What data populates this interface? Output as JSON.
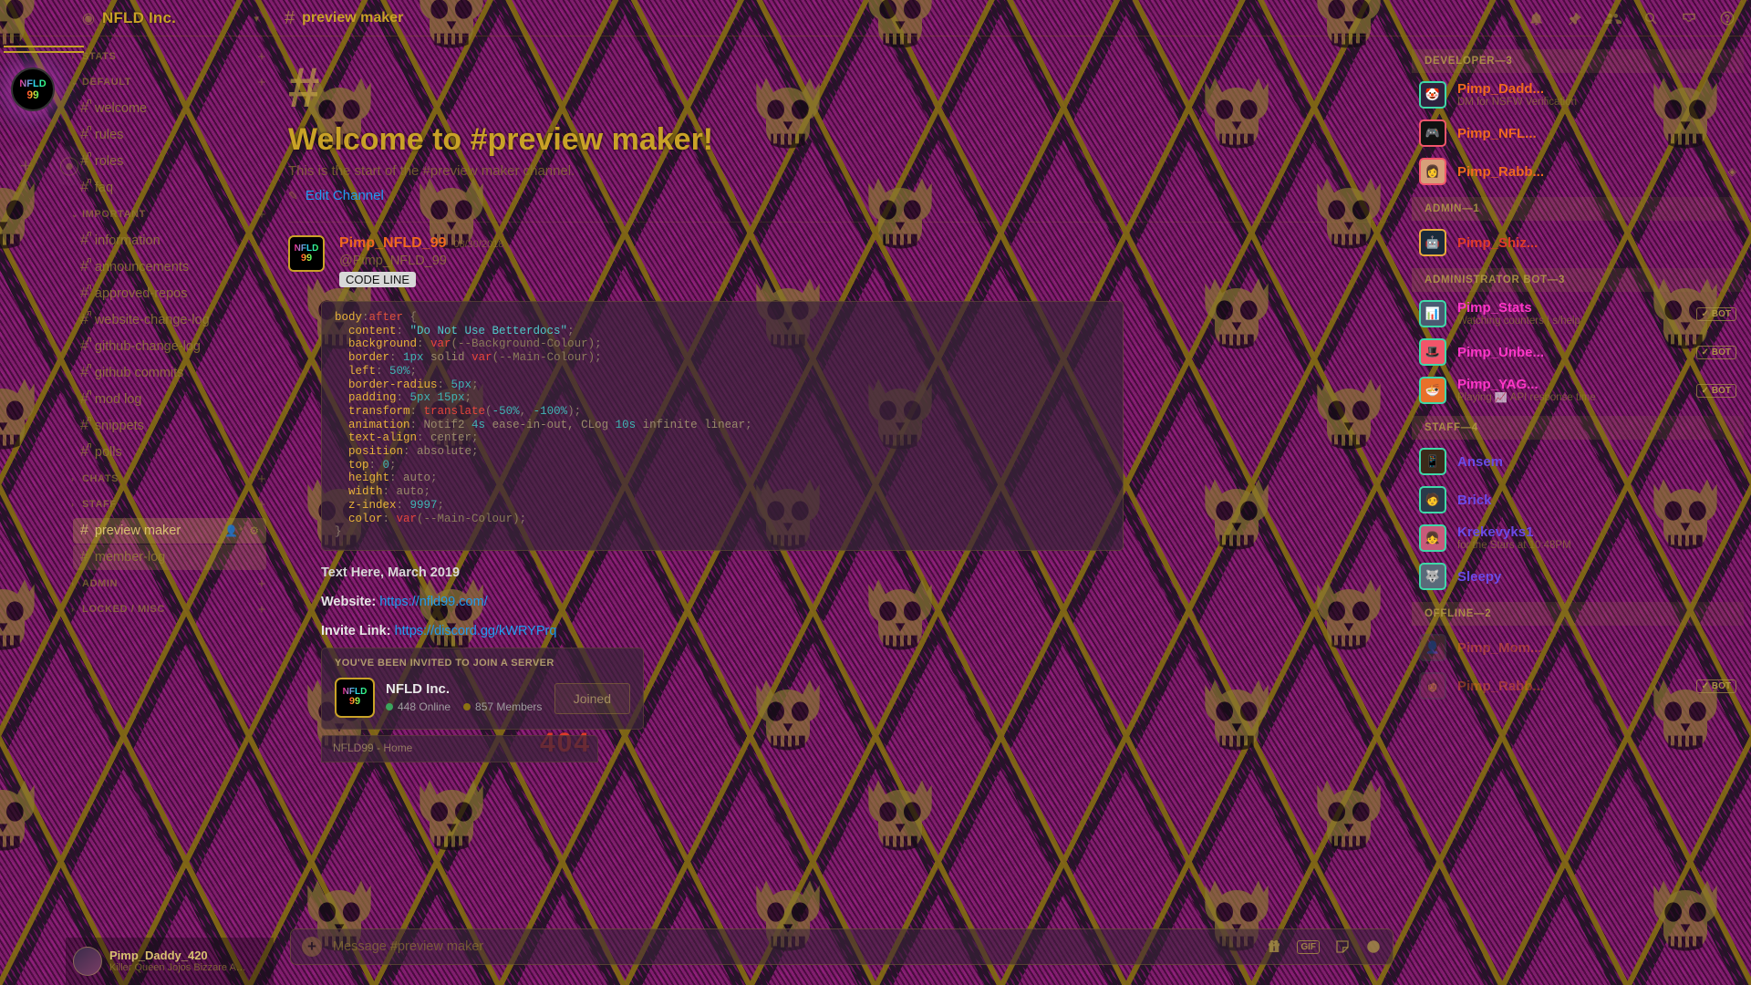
{
  "window": {
    "guild_name": "NFLD Inc.",
    "channel_name": "preview maker",
    "channel_hash": "#"
  },
  "topbar": {
    "icons": [
      {
        "name": "bell-icon",
        "glyph": "🔔"
      },
      {
        "name": "pin-icon",
        "glyph": "📌"
      },
      {
        "name": "members-icon",
        "glyph": "👥"
      },
      {
        "name": "search-icon",
        "glyph": "🔍"
      },
      {
        "name": "inbox-icon",
        "glyph": "📥"
      },
      {
        "name": "help-icon",
        "glyph": "?"
      }
    ]
  },
  "rail": {
    "home_label_line1": "NFLD",
    "home_label_line2": "99",
    "add_server_glyph": "+",
    "explore_glyph": "⦿"
  },
  "sidebar": {
    "categories": [
      {
        "label": "STATS",
        "collapsed": true,
        "arrow": "›",
        "channels": []
      },
      {
        "label": "DEFAULT",
        "collapsed": false,
        "arrow": "⌄",
        "channels": [
          {
            "name": "welcome",
            "locked": true
          },
          {
            "name": "rules",
            "locked": true
          },
          {
            "name": "roles",
            "locked": true
          },
          {
            "name": "faq",
            "locked": true
          }
        ]
      },
      {
        "label": "IMPORTANT",
        "collapsed": false,
        "arrow": "⌄",
        "channels": [
          {
            "name": "information",
            "locked": true
          },
          {
            "name": "announcements",
            "locked": true
          },
          {
            "name": "approved-repos",
            "locked": true
          },
          {
            "name": "website-change-log",
            "locked": true
          },
          {
            "name": "github-change-log",
            "locked": true
          },
          {
            "name": "github commits",
            "locked": true
          },
          {
            "name": "mod log",
            "locked": true
          },
          {
            "name": "snippets",
            "locked": true
          },
          {
            "name": "polls",
            "locked": true
          }
        ]
      },
      {
        "label": "CHATS",
        "collapsed": true,
        "arrow": "›",
        "channels": []
      },
      {
        "label": "STAFF",
        "collapsed": true,
        "arrow": "›",
        "channels": []
      }
    ],
    "highlighted": [
      {
        "name": "preview maker",
        "state": "selected",
        "controls": [
          "👤⁺",
          "⚙"
        ]
      },
      {
        "name": "member-log",
        "state": "hovered",
        "controls": []
      }
    ],
    "trailing_categories": [
      {
        "label": "ADMIN",
        "arrow": "›"
      },
      {
        "label": "LOCKED / MISC",
        "arrow": "›"
      }
    ]
  },
  "user_panel": {
    "username": "Pimp_Daddy_420",
    "status": "Killer Queen Jojos Bizzare Adv..."
  },
  "welcome": {
    "hash": "#",
    "title": "Welcome to #preview maker!",
    "subtitle": "This is the start of the #preview maker channel.",
    "edit_link": "Edit Channel",
    "pencil_glyph": "✎"
  },
  "message": {
    "author": "Pimp_NFLD_99",
    "timestamp": "08/30/2018",
    "handle": "@Pimp_NFLD_99",
    "tag": "CODE LINE",
    "avatar_line1": "NFLD",
    "avatar_line2": "99"
  },
  "code_block": {
    "language": "css",
    "lines": [
      [
        {
          "t": "body",
          "c": "c-prop"
        },
        {
          "t": ":",
          "c": "c-punc"
        },
        {
          "t": "after",
          "c": "c-pseudo"
        },
        {
          "t": " {",
          "c": "c-punc"
        }
      ],
      [
        {
          "t": "  content",
          "c": "c-prop"
        },
        {
          "t": ": ",
          "c": "c-punc"
        },
        {
          "t": "\"Do Not Use Betterdocs\"",
          "c": "c-str"
        },
        {
          "t": ";",
          "c": "c-punc"
        }
      ],
      [
        {
          "t": "  background",
          "c": "c-prop"
        },
        {
          "t": ": ",
          "c": "c-punc"
        },
        {
          "t": "var",
          "c": "c-fn"
        },
        {
          "t": "(--Background-Colour)",
          "c": "c-var"
        },
        {
          "t": ";",
          "c": "c-punc"
        }
      ],
      [
        {
          "t": "  border",
          "c": "c-prop"
        },
        {
          "t": ": ",
          "c": "c-punc"
        },
        {
          "t": "1px",
          "c": "c-num"
        },
        {
          "t": " solid ",
          "c": "c-kw"
        },
        {
          "t": "var",
          "c": "c-fn"
        },
        {
          "t": "(--Main-Colour)",
          "c": "c-var"
        },
        {
          "t": ";",
          "c": "c-punc"
        }
      ],
      [
        {
          "t": "  left",
          "c": "c-prop"
        },
        {
          "t": ": ",
          "c": "c-punc"
        },
        {
          "t": "50%",
          "c": "c-num"
        },
        {
          "t": ";",
          "c": "c-punc"
        }
      ],
      [
        {
          "t": "  border-radius",
          "c": "c-prop"
        },
        {
          "t": ": ",
          "c": "c-punc"
        },
        {
          "t": "5px",
          "c": "c-num"
        },
        {
          "t": ";",
          "c": "c-punc"
        }
      ],
      [
        {
          "t": "  padding",
          "c": "c-prop"
        },
        {
          "t": ": ",
          "c": "c-punc"
        },
        {
          "t": "5px 15px",
          "c": "c-num"
        },
        {
          "t": ";",
          "c": "c-punc"
        }
      ],
      [
        {
          "t": "  transform",
          "c": "c-prop"
        },
        {
          "t": ": ",
          "c": "c-punc"
        },
        {
          "t": "translate",
          "c": "c-fn"
        },
        {
          "t": "(",
          "c": "c-punc"
        },
        {
          "t": "-50%",
          "c": "c-num"
        },
        {
          "t": ", ",
          "c": "c-punc"
        },
        {
          "t": "-100%",
          "c": "c-num"
        },
        {
          "t": ");",
          "c": "c-punc"
        }
      ],
      [
        {
          "t": "  animation",
          "c": "c-prop"
        },
        {
          "t": ": ",
          "c": "c-punc"
        },
        {
          "t": "Notif2 ",
          "c": "c-kw"
        },
        {
          "t": "4s",
          "c": "c-num"
        },
        {
          "t": " ease-in-out, CLog ",
          "c": "c-kw"
        },
        {
          "t": "10s",
          "c": "c-num"
        },
        {
          "t": " infinite linear",
          "c": "c-kw"
        },
        {
          "t": ";",
          "c": "c-punc"
        }
      ],
      [
        {
          "t": "  text-align",
          "c": "c-prop"
        },
        {
          "t": ": ",
          "c": "c-punc"
        },
        {
          "t": "center",
          "c": "c-kw"
        },
        {
          "t": ";",
          "c": "c-punc"
        }
      ],
      [
        {
          "t": "  position",
          "c": "c-prop"
        },
        {
          "t": ": ",
          "c": "c-punc"
        },
        {
          "t": "absolute",
          "c": "c-kw"
        },
        {
          "t": ";",
          "c": "c-punc"
        }
      ],
      [
        {
          "t": "  top",
          "c": "c-prop"
        },
        {
          "t": ": ",
          "c": "c-punc"
        },
        {
          "t": "0",
          "c": "c-num"
        },
        {
          "t": ";",
          "c": "c-punc"
        }
      ],
      [
        {
          "t": "  height",
          "c": "c-prop"
        },
        {
          "t": ": ",
          "c": "c-punc"
        },
        {
          "t": "auto",
          "c": "c-kw"
        },
        {
          "t": ";",
          "c": "c-punc"
        }
      ],
      [
        {
          "t": "  width",
          "c": "c-prop"
        },
        {
          "t": ": ",
          "c": "c-punc"
        },
        {
          "t": "auto",
          "c": "c-kw"
        },
        {
          "t": ";",
          "c": "c-punc"
        }
      ],
      [
        {
          "t": "  z-index",
          "c": "c-prop"
        },
        {
          "t": ": ",
          "c": "c-punc"
        },
        {
          "t": "9997",
          "c": "c-num"
        },
        {
          "t": ";",
          "c": "c-punc"
        }
      ],
      [
        {
          "t": "  color",
          "c": "c-prop"
        },
        {
          "t": ": ",
          "c": "c-punc"
        },
        {
          "t": "var",
          "c": "c-fn"
        },
        {
          "t": "(--Main-Colour)",
          "c": "c-var"
        },
        {
          "t": ";",
          "c": "c-punc"
        }
      ],
      [
        {
          "t": "}",
          "c": "c-punc"
        }
      ]
    ]
  },
  "chat_lines": {
    "text_here": "Text Here, March 2019",
    "website_label": "Website:",
    "website_url": "https://nfld99.com/",
    "invite_label": "Invite Link:",
    "invite_url": "https://discord.gg/kWRYPrq"
  },
  "invite_embed": {
    "title": "YOU'VE BEEN INVITED TO JOIN A SERVER",
    "server_name": "NFLD Inc.",
    "online_count": "448 Online",
    "members_count": "857 Members",
    "button_label": "Joined",
    "online_color": "#3ba55d",
    "members_color": "#8c7212",
    "icon_line1": "NFLD",
    "icon_line2": "99"
  },
  "second_embed": {
    "title": "NFLD99 - Home",
    "big_text": "404"
  },
  "composer": {
    "placeholder": "Message #preview maker",
    "value": "",
    "plus_glyph": "+",
    "icons": [
      {
        "name": "gift-icon",
        "glyph": "🎁"
      },
      {
        "name": "gif-icon",
        "glyph": "GIF"
      },
      {
        "name": "sticker-icon",
        "glyph": "🖼"
      },
      {
        "name": "emoji-icon",
        "glyph": "🙂"
      }
    ]
  },
  "member_list": {
    "groups": [
      {
        "label": "DEVELOPER—3",
        "members": [
          {
            "name": "Pimp_Dadd...",
            "status": "DM for NSFW Verification",
            "color": "#f06a1e",
            "bot": false,
            "badge": "",
            "av_bg": "#2f2240",
            "av_border": "#3fd8a8",
            "av_glyph": "🤡"
          },
          {
            "name": "Pimp_NFL...",
            "status": "",
            "color": "#f06a1e",
            "bot": false,
            "badge": "",
            "av_bg": "#111111",
            "av_border": "#f2556a",
            "av_glyph": "🎮"
          },
          {
            "name": "Pimp_Rabb...",
            "status": "",
            "color": "#f06a1e",
            "bot": false,
            "badge": "◈",
            "av_bg": "#d7a07a",
            "av_border": "#f2556a",
            "av_glyph": "👩"
          }
        ]
      },
      {
        "label": "ADMIN—1",
        "members": [
          {
            "name": "Pimp_Shiz...",
            "status": "",
            "color": "#e03a2a",
            "bot": false,
            "badge": "",
            "av_bg": "#1b2a3a",
            "av_border": "#e8a93c",
            "av_glyph": "🤖"
          }
        ]
      },
      {
        "label": "ADMINISTRATOR BOT—3",
        "members": [
          {
            "name": "Pimp_Stats",
            "status": "Watching counters | s/help",
            "color": "#ff36c8",
            "bot": true,
            "badge": "",
            "av_bg": "#4a5a72",
            "av_border": "#3fd8a8",
            "av_glyph": "📊"
          },
          {
            "name": "Pimp_Unbe...",
            "status": "",
            "color": "#ff36c8",
            "bot": true,
            "badge": "",
            "av_bg": "#f2556a",
            "av_border": "#3fd8a8",
            "av_glyph": "🎩"
          },
          {
            "name": "Pimp_YAG...",
            "status": "Playing 📈 API response time",
            "color": "#ff36c8",
            "bot": true,
            "badge": "",
            "av_bg": "#e8702a",
            "av_border": "#3fd8a8",
            "av_glyph": "🍜"
          }
        ]
      },
      {
        "label": "STAFF—4",
        "members": [
          {
            "name": "Ansem",
            "status": "",
            "color": "#6b4ae8",
            "bot": false,
            "badge": "",
            "av_bg": "#3a2a1a",
            "av_border": "#3fd8a8",
            "av_glyph": "📱"
          },
          {
            "name": "Brick",
            "status": "",
            "color": "#6b4ae8",
            "bot": false,
            "badge": "",
            "av_bg": "#2a3a4a",
            "av_border": "#3fd8a8",
            "av_glyph": "🧑"
          },
          {
            "name": "Krekevyks1",
            "status": "for the Stars at 10:48PM",
            "color": "#6b4ae8",
            "bot": false,
            "badge": "",
            "av_bg": "#c85a7a",
            "av_border": "#3fd8a8",
            "av_glyph": "👧"
          },
          {
            "name": "Sleepy",
            "status": "",
            "color": "#6b4ae8",
            "bot": false,
            "badge": "",
            "av_bg": "#5a6a7a",
            "av_border": "#3fd8a8",
            "av_glyph": "🐺"
          }
        ]
      },
      {
        "label": "OFFLINE—2",
        "members": [
          {
            "name": "Pimp_Mom...",
            "status": "",
            "color": "#f06a1e",
            "bot": false,
            "badge": "",
            "av_bg": "#6a4a3a",
            "av_border": "#555555",
            "av_glyph": "👤",
            "offline": true
          },
          {
            "name": "Pimp_Rabb...",
            "status": "",
            "color": "#f06a1e",
            "bot": true,
            "badge": "",
            "av_bg": "#8a3a5a",
            "av_border": "#555555",
            "av_glyph": "👩",
            "offline": true
          }
        ]
      }
    ]
  },
  "theme": {
    "main_colour": "#c9a227",
    "background_colour": "#241527",
    "accent_magenta": "#9c1682",
    "link_blue": "#1f9cf0"
  }
}
